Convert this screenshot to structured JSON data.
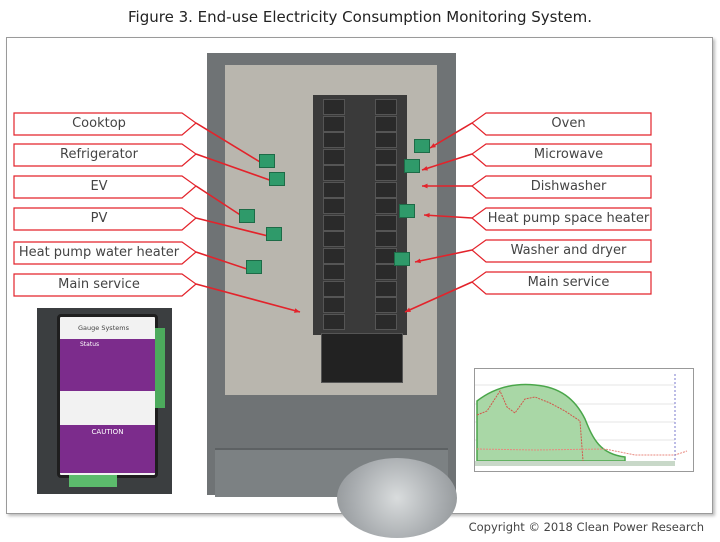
{
  "title": "Figure 3. End-use Electricity Consumption Monitoring System.",
  "copyright": "Copyright © 2018 Clean Power Research",
  "accent_color": "#e3232b",
  "left_labels": [
    {
      "label": "Cooktop"
    },
    {
      "label": "Refrigerator"
    },
    {
      "label": "EV"
    },
    {
      "label": "PV"
    },
    {
      "label": "Heat pump water heater"
    },
    {
      "label": "Main service"
    }
  ],
  "right_labels": [
    {
      "label": "Oven"
    },
    {
      "label": "Microwave"
    },
    {
      "label": "Dishwasher"
    },
    {
      "label": "Heat pump space heater"
    },
    {
      "label": "Washer and dryer"
    },
    {
      "label": "Main service"
    }
  ],
  "device": {
    "brand": "Gauge Systems",
    "status": "Status",
    "caution": "CAUTION"
  }
}
